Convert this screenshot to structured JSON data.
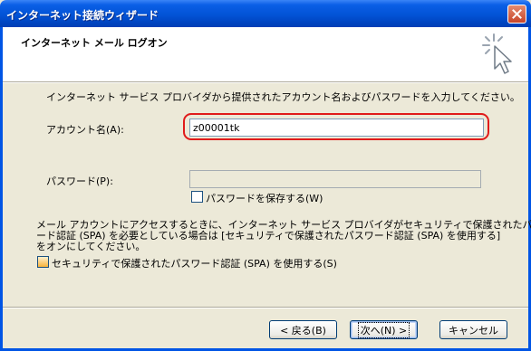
{
  "window": {
    "title": "インターネット接続ウィザード"
  },
  "header": {
    "title": "インターネット メール ログオン"
  },
  "instruction": "インターネット サービス プロバイダから提供されたアカウント名およびパスワードを入力してください。",
  "account": {
    "label": "アカウント名(A):",
    "value": "z00001tk"
  },
  "password": {
    "label": "パスワード(P):",
    "value": ""
  },
  "save_password": {
    "label": "パスワードを保存する(W)",
    "checked": false
  },
  "spa_description": [
    "メール アカウントにアクセスするときに、インターネット サービス プロバイダがセキュリティで保護されたパスワ",
    "ード認証 (SPA) を必要としている場合は [セキュリティで保護されたパスワード認証 (SPA) を使用する]",
    "をオンにしてください。"
  ],
  "spa_checkbox": {
    "label": "セキュリティで保護されたパスワード認証 (SPA) を使用する(S)",
    "checked": false
  },
  "buttons": {
    "back": "< 戻る(B)",
    "next": "次へ(N) >",
    "cancel": "キャンセル"
  },
  "icons": {
    "close": "close-icon",
    "wizard": "wizard-cursor-icon"
  },
  "colors": {
    "titlebar": "#0054E3",
    "highlight": "#E01B1B",
    "background": "#ECE9D8"
  }
}
